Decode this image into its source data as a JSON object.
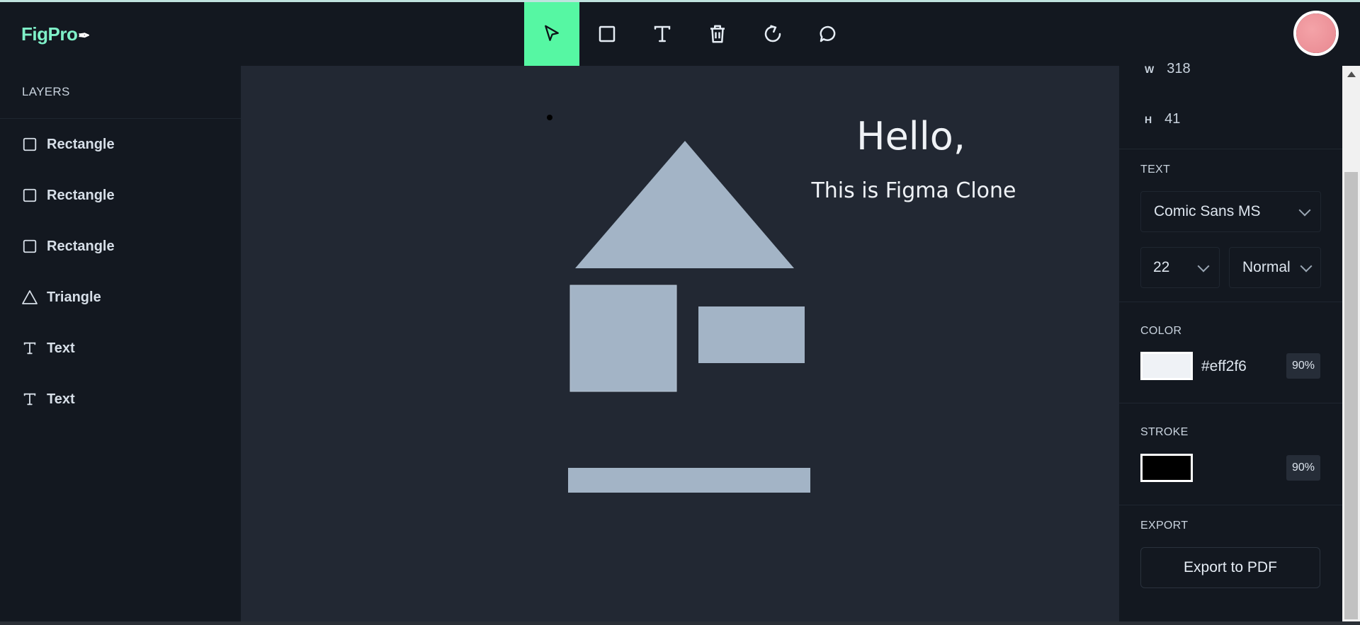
{
  "app": {
    "logo_text": "FigPro"
  },
  "toolbar": {
    "tools": [
      {
        "icon": "cursor-icon",
        "active": true
      },
      {
        "icon": "rectangle-icon"
      },
      {
        "icon": "text-icon"
      },
      {
        "icon": "trash-icon"
      },
      {
        "icon": "reset-icon"
      },
      {
        "icon": "comment-icon"
      }
    ]
  },
  "layers": {
    "title": "LAYERS",
    "items": [
      {
        "label": "Rectangle",
        "icon": "rectangle-icon"
      },
      {
        "label": "Rectangle",
        "icon": "rectangle-icon"
      },
      {
        "label": "Rectangle",
        "icon": "rectangle-icon"
      },
      {
        "label": "Triangle",
        "icon": "triangle-icon"
      },
      {
        "label": "Text",
        "icon": "text-icon"
      },
      {
        "label": "Text",
        "icon": "text-icon"
      }
    ]
  },
  "canvas": {
    "text1": "Hello,",
    "text2": "This is Figma Clone",
    "shape_color": "#a3b4c6",
    "text_color": "#eff2f6"
  },
  "properties": {
    "w_label": "W",
    "w_value": "318",
    "h_label": "H",
    "h_value": "41",
    "text_title": "TEXT",
    "font_family": "Comic Sans MS",
    "font_size": "22",
    "font_weight": "Normal",
    "color_title": "COLOR",
    "color_hex": "#eff2f6",
    "color_opacity": "90%",
    "stroke_title": "STROKE",
    "stroke_color": "#000000",
    "stroke_opacity": "90%",
    "export_title": "EXPORT",
    "export_button": "Export to PDF"
  }
}
